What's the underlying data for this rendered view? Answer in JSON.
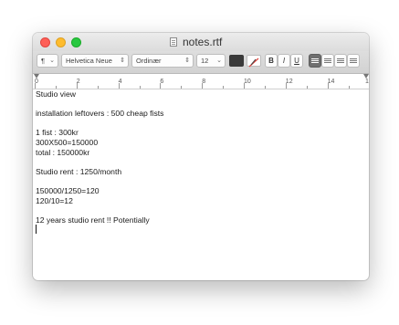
{
  "window": {
    "title": "notes.rtf"
  },
  "toolbar": {
    "paragraph_menu": "¶",
    "font_family": "Helvetica Neue",
    "font_style": "Ordinær",
    "font_size": "12",
    "bold_label": "B",
    "italic_label": "I",
    "underline_label": "U",
    "text_color": "#3a3a3a",
    "active_alignment": "left"
  },
  "ruler": {
    "labels": [
      "0",
      "2",
      "4",
      "6",
      "8",
      "10",
      "12",
      "14",
      "1"
    ]
  },
  "document": {
    "lines": [
      "Studio view",
      "",
      "installation leftovers : 500 cheap fists",
      "",
      "1 fist : 300kr",
      "300X500=150000",
      "total : 150000kr",
      "",
      "Studio rent : 1250/month",
      "",
      "150000/1250=120",
      "120/10=12",
      "",
      "12 years studio rent !! Potentially"
    ]
  }
}
